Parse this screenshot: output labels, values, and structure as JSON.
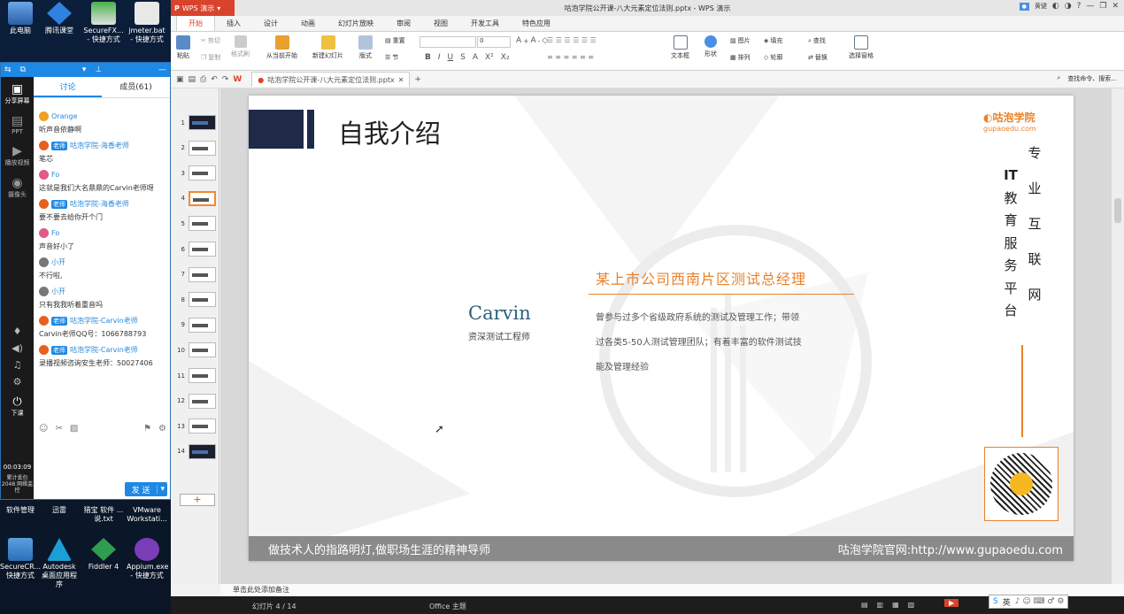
{
  "desktop": {
    "icons_top": [
      "此电脑",
      "腾讯课堂",
      "SecureFX... - 快捷方式",
      "jmeter.bat - 快捷方式"
    ],
    "icons_mid": [
      "软件管理",
      "迅雷",
      "猎宝 软件 ...说.txt",
      "VMware Workstati..."
    ],
    "icons_bottom": [
      "SecureCR... 快捷方式",
      "Autodesk 桌面应用程序",
      "Fiddler 4",
      "Appium.exe - 快捷方式"
    ]
  },
  "chat": {
    "tabs": [
      "讨论",
      "成员(61)"
    ],
    "side": [
      "分享屏幕",
      "PPT",
      "播放视频",
      "摄像头"
    ],
    "messages": [
      {
        "name": "Orange",
        "teacher": false,
        "color": "#f0a020",
        "text": "听声音依静啊"
      },
      {
        "name": "咕泡学院-海香老师",
        "teacher": true,
        "color": "#e86020",
        "text": "笔芯"
      },
      {
        "name": "Fo",
        "teacher": false,
        "color": "#e05a8a",
        "text": "这就是我们大名鼎鼎的Carvin老师呀"
      },
      {
        "name": "咕泡学院-海香老师",
        "teacher": true,
        "color": "#e86020",
        "text": "要不要去给你开个门"
      },
      {
        "name": "Fo",
        "teacher": false,
        "color": "#e05a8a",
        "text": "声音好小了"
      },
      {
        "name": "小开",
        "teacher": false,
        "color": "#777777",
        "text": "不行啦,"
      },
      {
        "name": "小开",
        "teacher": false,
        "color": "#777777",
        "text": "只有我我听着重音吗"
      },
      {
        "name": "咕泡学院-Carvin老师",
        "teacher": true,
        "color": "#e86020",
        "text": "Carvin老师QQ号：1066788793"
      },
      {
        "name": "咕泡学院-Carvin老师",
        "teacher": true,
        "color": "#e86020",
        "text": "录播视频咨询安生老师：50027406"
      }
    ],
    "teacher_tag": "老师",
    "send_label": "发 送",
    "bottom_label": "下课",
    "time": "00:03:09",
    "net": "累计丢包 2048 网络监控"
  },
  "wps": {
    "logo": "WPS 演示",
    "title": "咕泡学院公开课-八大元素定位法则.pptx - WPS 演示",
    "user": "黄键",
    "tabs": [
      "开始",
      "插入",
      "设计",
      "动画",
      "幻灯片放映",
      "审阅",
      "视图",
      "开发工具",
      "特色应用"
    ],
    "ribbon": {
      "paste": "粘贴",
      "cut": "剪切",
      "copy": "复制",
      "format_painter": "格式刷",
      "from_current": "从当前开始",
      "new_slide": "新建幻灯片",
      "layout": "版式",
      "reset": "重置",
      "section": "节",
      "font_size": "0",
      "textbox": "文本框",
      "shape": "形状",
      "picture": "图片",
      "fill": "填充",
      "arrange": "排列",
      "outline": "轮廓",
      "find": "查找",
      "replace": "替换",
      "select_pane": "选择窗格"
    },
    "doc_tab": "咕泡学院公开课-八大元素定位法则.pptx",
    "search_placeholder": "查找命令、搜索..."
  },
  "thumbs": [
    "1",
    "2",
    "3",
    "4",
    "5",
    "6",
    "7",
    "8",
    "9",
    "10",
    "11",
    "12",
    "13",
    "14"
  ],
  "selected_slide": 4,
  "slide": {
    "title": "自我介绍",
    "brand": "咕泡学院",
    "brand_url": "gupaoedu.com",
    "vertical_left": [
      "IT",
      "教",
      "育",
      "服",
      "务",
      "平",
      "台"
    ],
    "vertical_right": [
      "专",
      "业",
      "互",
      "联",
      "网"
    ],
    "name": "Carvin",
    "role": "资深测试工程师",
    "position": "某上市公司西南片区测试总经理",
    "desc_lines": [
      "曾参与过多个省级政府系统的测试及管理工作；带领",
      "过各类5-50人测试管理团队；有着丰富的软件测试技",
      "能及管理经验"
    ],
    "footer_left": "做技术人的指路明灯,做职场生涯的精神导师",
    "footer_right": "咕泡学院官网:http://www.gupaoedu.com"
  },
  "notes": "单击此处添加备注",
  "status": {
    "slide": "幻灯片 4 / 14",
    "theme": "Office 主题"
  },
  "ime": "英"
}
